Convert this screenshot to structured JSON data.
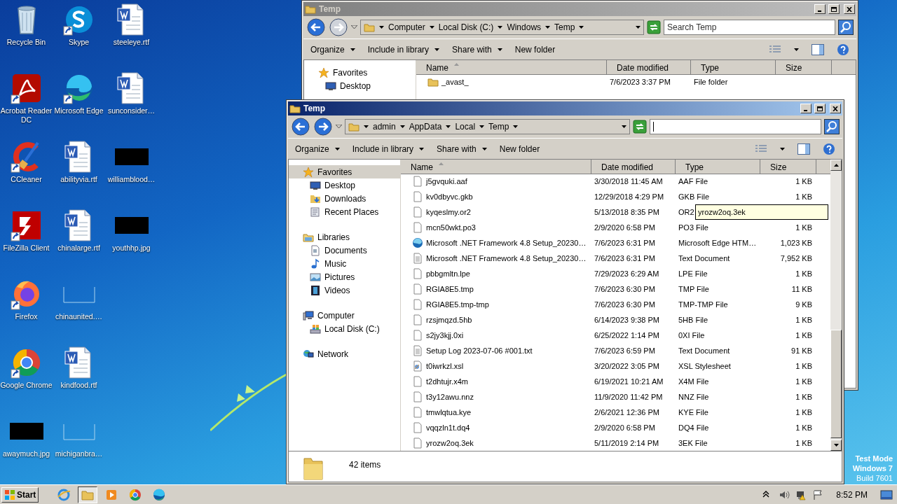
{
  "desktop_icons": [
    {
      "label": "Recycle Bin",
      "kind": "recycle",
      "shortcut": false
    },
    {
      "label": "Acrobat Reader DC",
      "kind": "acrobat",
      "shortcut": true
    },
    {
      "label": "CCleaner",
      "kind": "ccleaner",
      "shortcut": true
    },
    {
      "label": "FileZilla Client",
      "kind": "filezilla",
      "shortcut": true
    },
    {
      "label": "Firefox",
      "kind": "firefox",
      "shortcut": true
    },
    {
      "label": "Google Chrome",
      "kind": "chrome",
      "shortcut": true
    },
    {
      "label": "awaymuch.jpg",
      "kind": "dark-thumb",
      "shortcut": false
    },
    {
      "label": "Skype",
      "kind": "skype",
      "shortcut": true
    },
    {
      "label": "Microsoft Edge",
      "kind": "edge",
      "shortcut": true
    },
    {
      "label": "abilityvia.rtf",
      "kind": "word",
      "shortcut": false
    },
    {
      "label": "chinalarge.rtf",
      "kind": "word",
      "shortcut": false
    },
    {
      "label": "chinaunited.…",
      "kind": "blank-thumb",
      "shortcut": false
    },
    {
      "label": "kindfood.rtf",
      "kind": "word",
      "shortcut": false
    },
    {
      "label": "michiganbra…",
      "kind": "blank-thumb",
      "shortcut": false
    },
    {
      "label": "steeleye.rtf",
      "kind": "word",
      "shortcut": false
    },
    {
      "label": "sunconsider…",
      "kind": "word",
      "shortcut": false
    },
    {
      "label": "williamblood…",
      "kind": "dark-thumb",
      "shortcut": false
    },
    {
      "label": "youthhp.jpg",
      "kind": "dark-thumb",
      "shortcut": false
    }
  ],
  "windows": [
    {
      "title": "Temp",
      "active": false,
      "breadcrumbs": [
        "Computer",
        "Local Disk (C:)",
        "Windows",
        "Temp"
      ],
      "search": {
        "placeholder": "Search Temp",
        "focused": false
      },
      "toolbar": [
        {
          "label": "Organize",
          "dropdown": true
        },
        {
          "label": "Include in library",
          "dropdown": true
        },
        {
          "label": "Share with",
          "dropdown": true
        },
        {
          "label": "New folder",
          "dropdown": false
        }
      ],
      "nav": [
        {
          "label": "Favorites",
          "kind": "star",
          "selected": false,
          "children": [
            {
              "label": "Desktop",
              "kind": "desktop",
              "selected": false
            }
          ]
        }
      ],
      "columns": [
        {
          "label": "Name",
          "sorted": true
        },
        {
          "label": "Date modified",
          "sorted": false
        },
        {
          "label": "Type",
          "sorted": false
        },
        {
          "label": "Size",
          "sorted": false
        }
      ],
      "files": [
        {
          "name": "_avast_",
          "date": "7/6/2023 3:37 PM",
          "type": "File folder",
          "kind": "folder"
        }
      ]
    },
    {
      "title": "Temp",
      "active": true,
      "breadcrumbs": [
        "admin",
        "AppData",
        "Local",
        "Temp"
      ],
      "search": {
        "focused": true
      },
      "toolbar": [
        {
          "label": "Organize",
          "dropdown": true
        },
        {
          "label": "Include in library",
          "dropdown": true
        },
        {
          "label": "Share with",
          "dropdown": true
        },
        {
          "label": "New folder",
          "dropdown": false
        }
      ],
      "nav": [
        {
          "label": "Favorites",
          "kind": "star",
          "selected": true,
          "children": [
            {
              "label": "Desktop",
              "kind": "desktop",
              "selected": false
            },
            {
              "label": "Downloads",
              "kind": "downloads",
              "selected": false
            },
            {
              "label": "Recent Places",
              "kind": "recent",
              "selected": false
            }
          ]
        },
        {
          "label": "Libraries",
          "kind": "library",
          "selected": false,
          "children": [
            {
              "label": "Documents",
              "kind": "documents",
              "selected": false
            },
            {
              "label": "Music",
              "kind": "music",
              "selected": false
            },
            {
              "label": "Pictures",
              "kind": "pictures",
              "selected": false
            },
            {
              "label": "Videos",
              "kind": "videos",
              "selected": false
            }
          ]
        },
        {
          "label": "Computer",
          "kind": "computer",
          "selected": false,
          "children": [
            {
              "label": "Local Disk (C:)",
              "kind": "disk",
              "selected": false
            }
          ]
        },
        {
          "label": "Network",
          "kind": "network",
          "selected": false
        }
      ],
      "columns": [
        {
          "label": "Name",
          "sorted": true
        },
        {
          "label": "Date modified",
          "sorted": false
        },
        {
          "label": "Type",
          "sorted": false
        },
        {
          "label": "Size",
          "sorted": false
        }
      ],
      "files": [
        {
          "name": "j5gvquki.aaf",
          "date": "3/30/2018 11:45 AM",
          "type": "AAF File",
          "size": "1 KB",
          "kind": "blank"
        },
        {
          "name": "kv0dbyvc.gkb",
          "date": "12/29/2018 4:29 PM",
          "type": "GKB File",
          "size": "1 KB",
          "kind": "blank"
        },
        {
          "name": "kyqeslmy.or2",
          "date": "5/13/2018 8:35 PM",
          "type": "OR2",
          "kind": "blank"
        },
        {
          "name": "mcn50wkt.po3",
          "date": "2/9/2020 6:58 PM",
          "type": "PO3 File",
          "size": "1 KB",
          "kind": "blank"
        },
        {
          "name": "Microsoft .NET Framework 4.8 Setup_20230…",
          "date": "7/6/2023 6:31 PM",
          "type": "Microsoft Edge HTM…",
          "size": "1,023 KB",
          "kind": "edge"
        },
        {
          "name": "Microsoft .NET Framework 4.8 Setup_20230…",
          "date": "7/6/2023 6:31 PM",
          "type": "Text Document",
          "size": "7,952 KB",
          "kind": "text"
        },
        {
          "name": "pbbgmltn.lpe",
          "date": "7/29/2023 6:29 AM",
          "type": "LPE File",
          "size": "1 KB",
          "kind": "blank"
        },
        {
          "name": "RGIA8E5.tmp",
          "date": "7/6/2023 6:30 PM",
          "type": "TMP File",
          "size": "11 KB",
          "kind": "blank"
        },
        {
          "name": "RGIA8E5.tmp-tmp",
          "date": "7/6/2023 6:30 PM",
          "type": "TMP-TMP File",
          "size": "9 KB",
          "kind": "blank"
        },
        {
          "name": "rzsjmqzd.5hb",
          "date": "6/14/2023 9:38 PM",
          "type": "5HB File",
          "size": "1 KB",
          "kind": "blank"
        },
        {
          "name": "s2jy3kjj.0xi",
          "date": "6/25/2022 1:14 PM",
          "type": "0XI File",
          "size": "1 KB",
          "kind": "blank"
        },
        {
          "name": "Setup Log 2023-07-06 #001.txt",
          "date": "7/6/2023 6:59 PM",
          "type": "Text Document",
          "size": "91 KB",
          "kind": "text"
        },
        {
          "name": "t0iwrkzl.xsl",
          "date": "3/20/2022 3:05 PM",
          "type": "XSL Stylesheet",
          "size": "1 KB",
          "kind": "xsl"
        },
        {
          "name": "t2dhtujr.x4m",
          "date": "6/19/2021 10:21 AM",
          "type": "X4M File",
          "size": "1 KB",
          "kind": "blank"
        },
        {
          "name": "t3y12awu.nnz",
          "date": "11/9/2020 11:42 PM",
          "type": "NNZ File",
          "size": "1 KB",
          "kind": "blank"
        },
        {
          "name": "tmwlqtua.kye",
          "date": "2/6/2021 12:36 PM",
          "type": "KYE File",
          "size": "1 KB",
          "kind": "blank"
        },
        {
          "name": "vqqzln1t.dq4",
          "date": "2/9/2020 6:58 PM",
          "type": "DQ4 File",
          "size": "1 KB",
          "kind": "blank"
        },
        {
          "name": "yrozw2oq.3ek",
          "date": "5/11/2019 2:14 PM",
          "type": "3EK File",
          "size": "1 KB",
          "kind": "blank"
        }
      ],
      "tooltip": {
        "text": "yrozw2oq.3ek"
      },
      "status": "42 items"
    }
  ],
  "desktop_notice": [
    "Test Mode",
    "Windows 7",
    "Build 7601"
  ],
  "taskbar": {
    "start": "Start",
    "apps": [
      {
        "kind": "ie",
        "selected": false
      },
      {
        "kind": "explorer",
        "selected": true
      },
      {
        "kind": "media",
        "selected": false
      },
      {
        "kind": "chrome",
        "selected": false
      },
      {
        "kind": "edge",
        "selected": false
      }
    ],
    "tray": [
      {
        "kind": "caret"
      },
      {
        "kind": "speaker"
      },
      {
        "kind": "network"
      },
      {
        "kind": "flag"
      }
    ],
    "clock": "8:52 PM"
  }
}
